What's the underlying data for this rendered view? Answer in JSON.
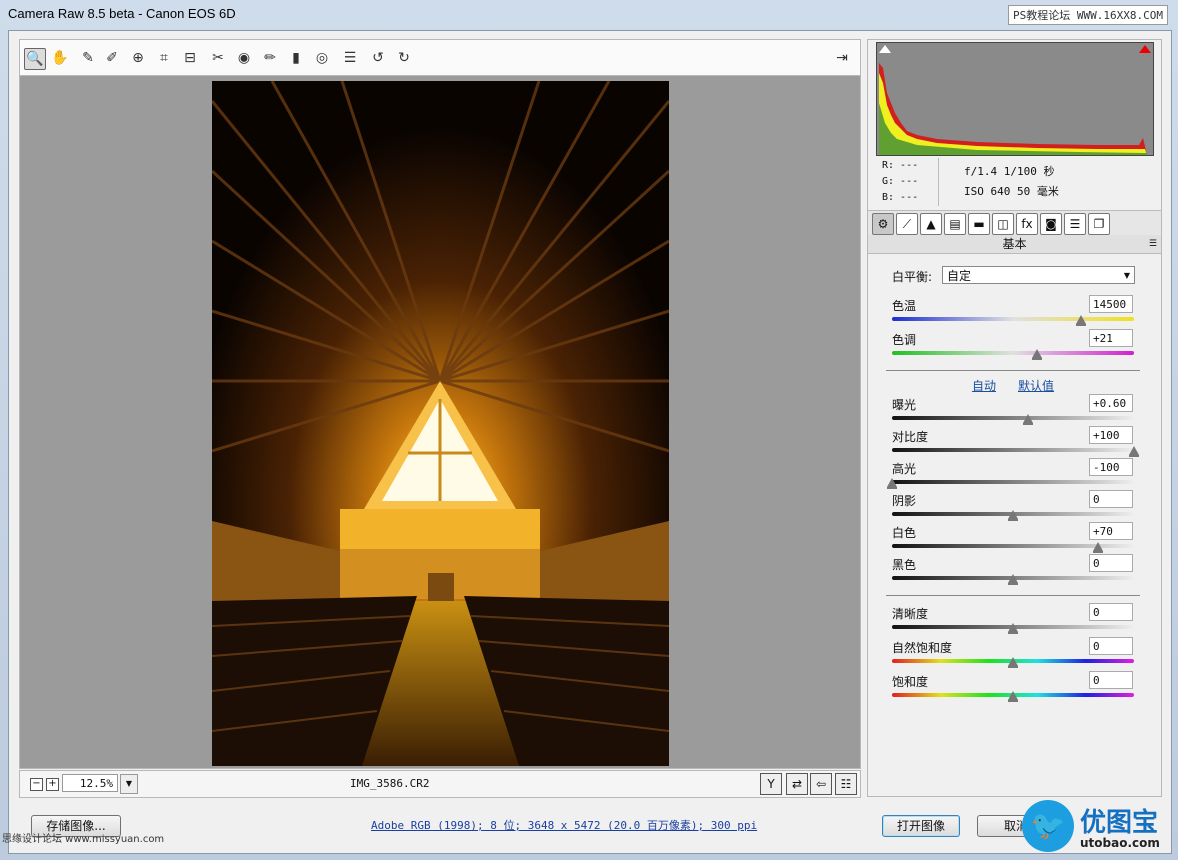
{
  "window": {
    "title": "Camera Raw 8.5 beta -  Canon EOS 6D",
    "watermark": "PS教程论坛 WWW.16XX8.COM"
  },
  "toolbar": {
    "tools": [
      "zoom-tool",
      "hand-tool",
      "white-balance-tool",
      "color-sampler-tool",
      "targeted-adjustment-tool",
      "crop-tool",
      "straighten-tool",
      "spot-removal-tool",
      "red-eye-tool",
      "adjustment-brush-tool",
      "graduated-filter-tool",
      "radial-filter-tool",
      "preferences",
      "rotate-ccw",
      "rotate-cw"
    ],
    "fullscreen_icon": "fullscreen-icon"
  },
  "preview": {
    "zoom": "12.5%",
    "filename": "IMG_3586.CR2"
  },
  "info": {
    "r": "R:  ---",
    "g": "G:  ---",
    "b": "B:  ---",
    "exif_line1": "f/1.4  1/100 秒",
    "exif_line2": "ISO 640  50 毫米"
  },
  "panel": {
    "section_title": "基本",
    "wb_label": "白平衡:",
    "wb_value": "自定",
    "auto_label": "自动",
    "default_label": "默认值",
    "sliders": [
      {
        "label": "色温",
        "value": "14500",
        "pos": 0.78
      },
      {
        "label": "色调",
        "value": "+21",
        "pos": 0.6
      },
      {
        "label": "曝光",
        "value": "+0.60",
        "pos": 0.56
      },
      {
        "label": "对比度",
        "value": "+100",
        "pos": 1.0
      },
      {
        "label": "高光",
        "value": "-100",
        "pos": 0.0
      },
      {
        "label": "阴影",
        "value": "0",
        "pos": 0.5
      },
      {
        "label": "白色",
        "value": "+70",
        "pos": 0.85
      },
      {
        "label": "黑色",
        "value": "0",
        "pos": 0.5
      },
      {
        "label": "清晰度",
        "value": "0",
        "pos": 0.5
      },
      {
        "label": "自然饱和度",
        "value": "0",
        "pos": 0.5
      },
      {
        "label": "饱和度",
        "value": "0",
        "pos": 0.5
      }
    ]
  },
  "footer": {
    "save_label": "存储图像...",
    "workflow_info": "Adobe RGB (1998); 8 位; 3648 x 5472 (20.0 百万像素); 300 ppi",
    "open_label": "打开图像",
    "cancel_label": "取消",
    "watermark_left": "思缘设计论坛 www.missyuan.com",
    "watermark_logo_text": "优图宝",
    "watermark_logo_url": "utobao.com"
  },
  "colors": {
    "link": "#1a4fa0",
    "histogram_bg": "#8a8a8a"
  }
}
